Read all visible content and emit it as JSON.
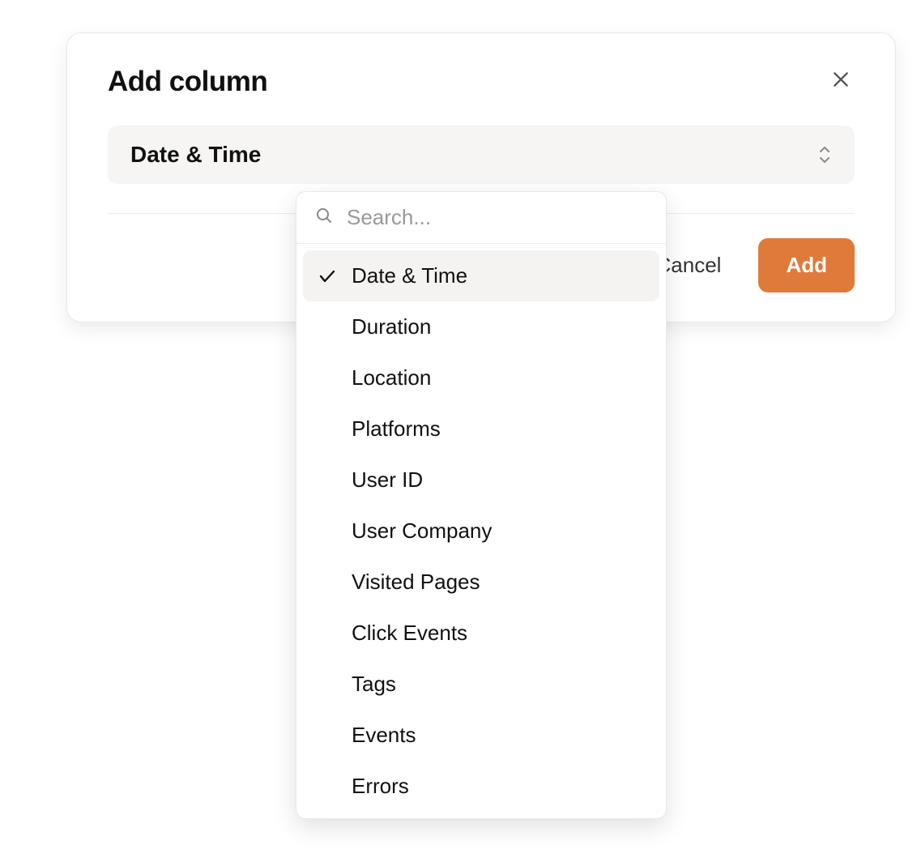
{
  "modal": {
    "title": "Add column",
    "select": {
      "value": "Date & Time"
    },
    "actions": {
      "cancel": "Cancel",
      "add": "Add"
    }
  },
  "dropdown": {
    "search_placeholder": "Search...",
    "selected_index": 0,
    "options": [
      "Date & Time",
      "Duration",
      "Location",
      "Platforms",
      "User ID",
      "User Company",
      "Visited Pages",
      "Click Events",
      "Tags",
      "Events",
      "Errors"
    ]
  }
}
